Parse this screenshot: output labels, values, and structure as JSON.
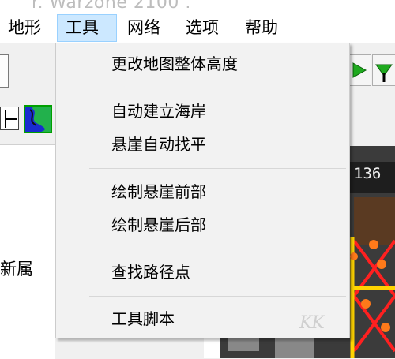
{
  "window": {
    "title": "r. Warzone 2100 ."
  },
  "menubar": {
    "items": [
      {
        "label": "地形",
        "active": false
      },
      {
        "label": "工具",
        "active": true
      },
      {
        "label": "网络",
        "active": false
      },
      {
        "label": "选项",
        "active": false
      },
      {
        "label": "帮助",
        "active": false
      }
    ]
  },
  "tools_menu": {
    "groups": [
      [
        "更改地图整体高度"
      ],
      [
        "自动建立海岸",
        "悬崖自动找平"
      ],
      [
        "绘制悬崖前部",
        "绘制悬崖后部"
      ],
      [
        "查找路径点"
      ],
      [
        "工具脚本"
      ]
    ]
  },
  "left_panel": {
    "partial_label": "新属"
  },
  "viewport": {
    "hud_number": "136"
  },
  "watermark": {
    "text": "KK"
  },
  "colors": {
    "menu_active_bg": "#cce8ff",
    "menu_active_border": "#99d1ff",
    "dropdown_bg": "#f2f2f2",
    "arrow_green": "#1faa1f"
  }
}
